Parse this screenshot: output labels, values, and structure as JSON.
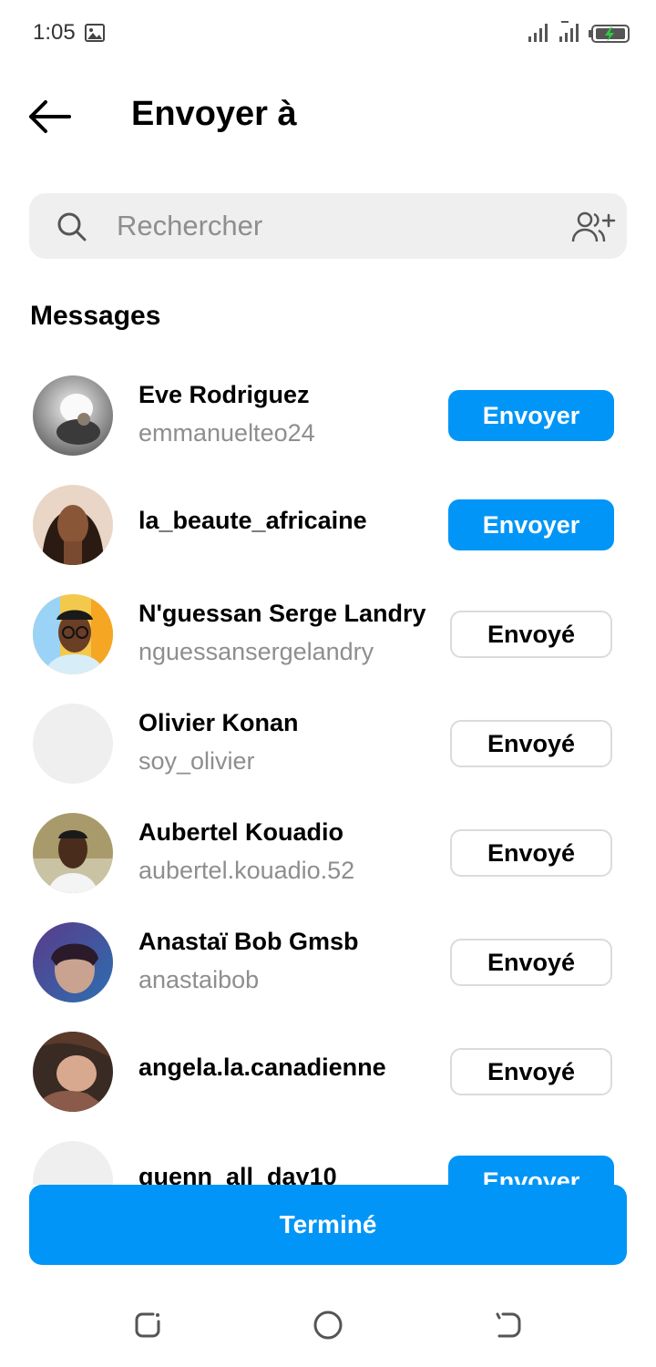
{
  "status_bar": {
    "time": "1:05",
    "icons": [
      "image-icon",
      "signal-icon",
      "signal-icon",
      "battery-charging-icon"
    ]
  },
  "header": {
    "title": "Envoyer à",
    "back_icon": "arrow-left-icon"
  },
  "search": {
    "placeholder": "Rechercher",
    "value": "",
    "icon": "search-icon",
    "add_icon": "add-people-icon"
  },
  "section": {
    "title": "Messages"
  },
  "contacts": [
    {
      "name": "Eve Rodriguez",
      "username": "emmanuelteo24",
      "action": "Envoyer",
      "state": "send"
    },
    {
      "name": "la_beaute_africaine",
      "username": "",
      "action": "Envoyer",
      "state": "send"
    },
    {
      "name": "N'guessan Serge Landry",
      "username": "nguessansergelandry",
      "action": "Envoyé",
      "state": "sent"
    },
    {
      "name": "Olivier Konan",
      "username": "soy_olivier",
      "action": "Envoyé",
      "state": "sent"
    },
    {
      "name": "Aubertel Kouadio",
      "username": "aubertel.kouadio.52",
      "action": "Envoyé",
      "state": "sent"
    },
    {
      "name": "Anastaï Bob Gmsb",
      "username": "anastaibob",
      "action": "Envoyé",
      "state": "sent"
    },
    {
      "name": "angela.la.canadienne",
      "username": "",
      "action": "Envoyé",
      "state": "sent"
    },
    {
      "name": "quenn_all_day10",
      "username": "",
      "action": "Envoyer",
      "state": "send"
    }
  ],
  "footer": {
    "done_label": "Terminé"
  },
  "colors": {
    "accent": "#0095f6",
    "secondary_text": "#8e8e8e",
    "search_bg": "#efefef"
  }
}
